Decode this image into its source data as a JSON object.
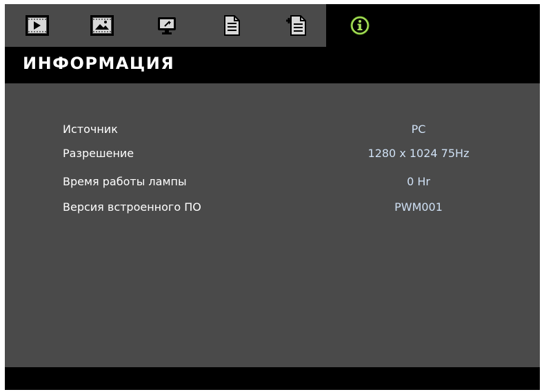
{
  "menu": {
    "tabs": [
      {
        "icon": "display-icon",
        "active": false
      },
      {
        "icon": "image-icon",
        "active": false
      },
      {
        "icon": "screen-icon",
        "active": false
      },
      {
        "icon": "setup-icon",
        "active": false
      },
      {
        "icon": "advanced-setup-icon",
        "active": false
      },
      {
        "icon": "info-icon",
        "active": true
      }
    ],
    "accent_color": "#a8e05a"
  },
  "page": {
    "title": "ИНФОРМАЦИЯ"
  },
  "info": {
    "rows": [
      {
        "label": "Источник",
        "value": "PC"
      },
      {
        "label": "Разрешение",
        "value": "1280 x 1024 75Hz"
      },
      {
        "label": "Время работы лампы",
        "value": "0 Hr"
      },
      {
        "label": "Версия встроенного ПО",
        "value": "PWM001"
      }
    ]
  }
}
